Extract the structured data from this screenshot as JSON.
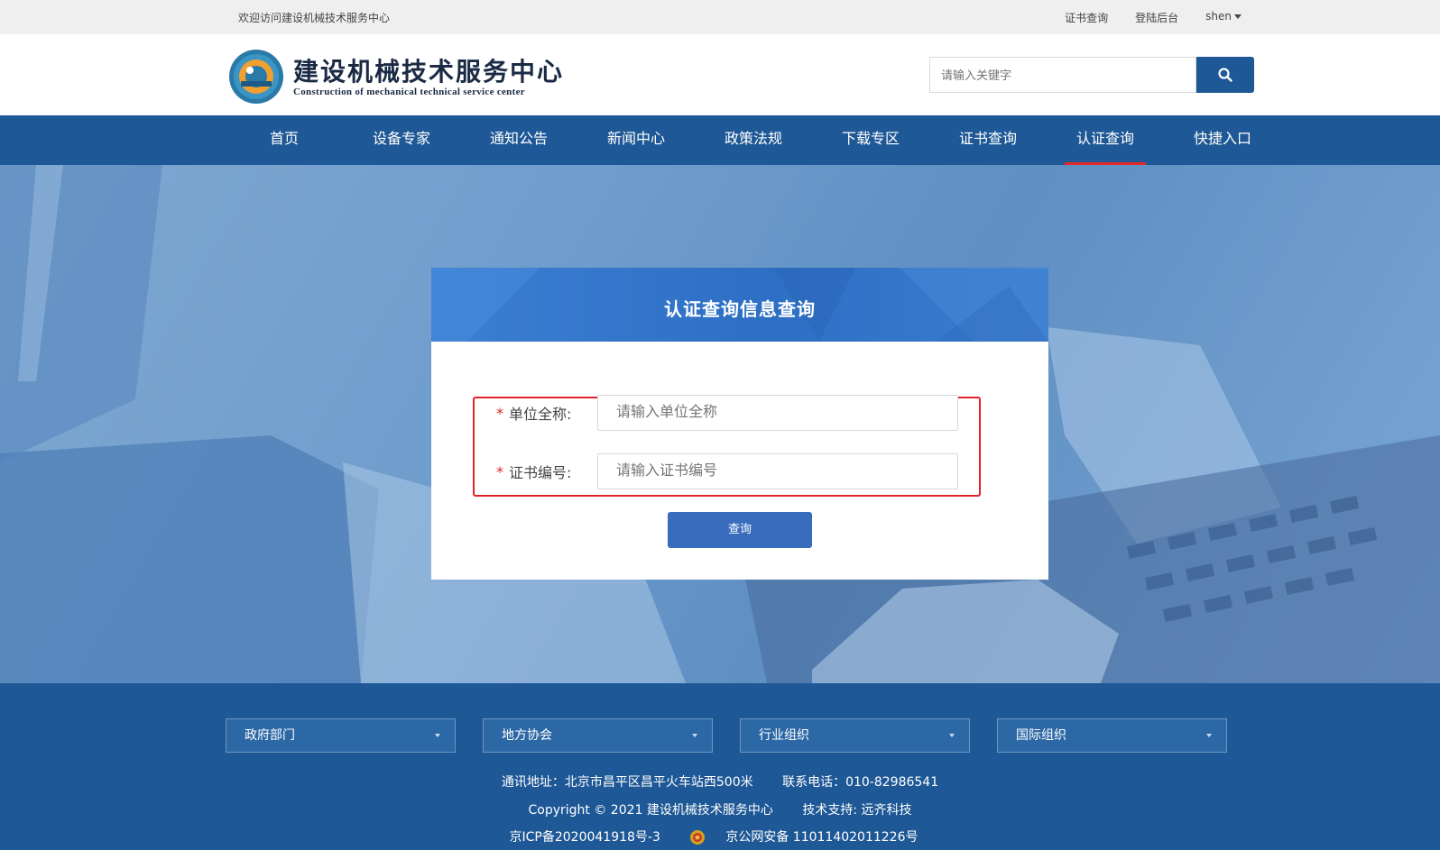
{
  "topbar": {
    "welcome": "欢迎访问建设机械技术服务中心",
    "links": [
      "证书查询",
      "登陆后台"
    ],
    "user": "shen"
  },
  "header": {
    "brand_cn": "建设机械技术服务中心",
    "brand_en": "Construction of mechanical technical service center",
    "search_placeholder": "请输入关键字",
    "search_icon": "search-icon"
  },
  "nav": {
    "items": [
      "首页",
      "设备专家",
      "通知公告",
      "新闻中心",
      "政策法规",
      "下载专区",
      "证书查询",
      "认证查询",
      "快捷入口"
    ],
    "active": "认证查询",
    "accent_color": "#e02b2b"
  },
  "card": {
    "title": "认证查询信息查询",
    "required_mark": "*",
    "fields": [
      {
        "label": "单位全称:",
        "placeholder": "请输入单位全称"
      },
      {
        "label": "证书编号:",
        "placeholder": "请输入证书编号"
      }
    ],
    "query_button": "查询"
  },
  "footer": {
    "selects": [
      "政府部门",
      "地方协会",
      "行业组织",
      "国际组织"
    ],
    "address": "通讯地址：北京市昌平区昌平火车站西500米",
    "phone": "联系电话：010-82986541",
    "copyright": "Copyright © 2021 建设机械技术服务中心",
    "support": "技术支持:   远齐科技",
    "icp": "京ICP备2020041918号-3",
    "police_record": "京公网安备 11011402011226号"
  },
  "colors": {
    "primary": "#1e5896",
    "button": "#3a6cbe",
    "highlight_border": "#e0232a"
  }
}
